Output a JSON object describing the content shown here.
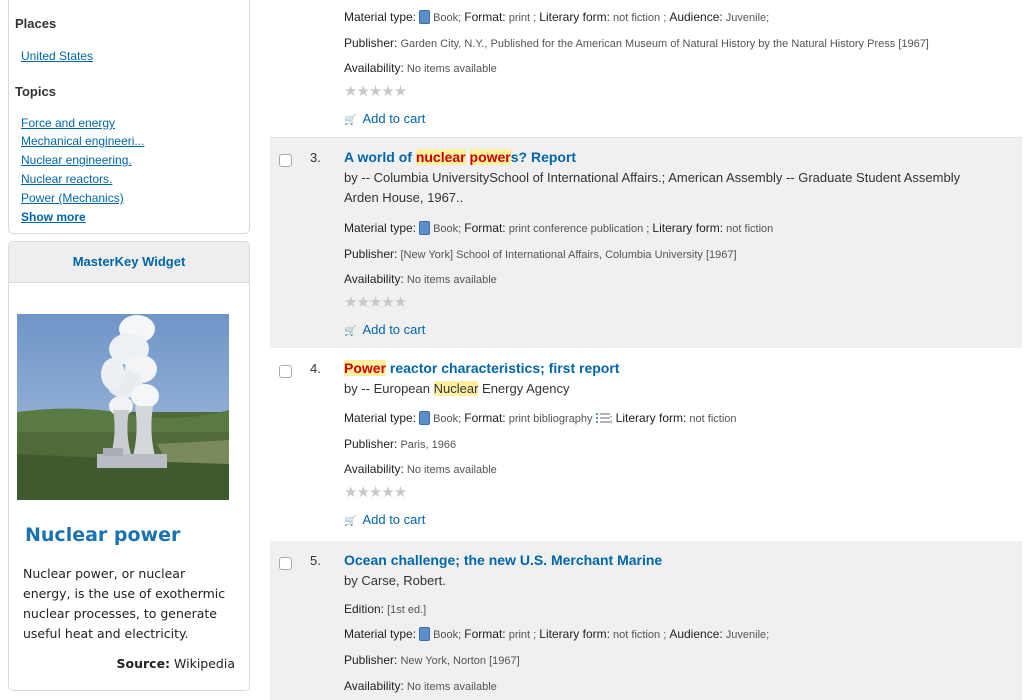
{
  "sidebar": {
    "places_heading": "Places",
    "places": [
      "United States"
    ],
    "topics_heading": "Topics",
    "topics": [
      "Force and energy",
      "Mechanical engineeri...",
      "Nuclear engineering.",
      "Nuclear reactors.",
      "Power (Mechanics)"
    ],
    "show_more": "Show more"
  },
  "widget": {
    "header": "MasterKey Widget",
    "title": "Nuclear power",
    "text": "Nuclear power, or nuclear energy, is the use of exothermic nuclear processes, to generate useful heat and electricity.",
    "source_label": "Source:",
    "source_value": "Wikipedia"
  },
  "labels": {
    "material_type": "Material type:",
    "format": "Format:",
    "literary_form": "Literary form:",
    "audience": "Audience:",
    "publisher": "Publisher:",
    "availability": "Availability:",
    "edition": "Edition:",
    "add_to_cart": "Add to cart",
    "book": "Book;",
    "sep": ";",
    "stars": "★★★★★"
  },
  "results": [
    {
      "format": "print",
      "literary_form": "not fiction",
      "audience": "Juvenile;",
      "publisher": "Garden City, N.Y., Published for the American Museum of Natural History by the Natural History Press [1967]",
      "availability": "No items available"
    },
    {
      "number": "3.",
      "title_pre": "A world of ",
      "title_hl1": "nuclear",
      "title_mid": " ",
      "title_hl2": "power",
      "title_post": "s? Report",
      "author_line1": "by -- Columbia UniversitySchool of International Affairs.; American Assembly -- Graduate Student Assembly",
      "author_line2": "Arden House, 1967..",
      "format": "print conference publication",
      "literary_form": "not fiction",
      "publisher": "[New York] School of International Affairs, Columbia University [1967]",
      "availability": "No items available"
    },
    {
      "number": "4.",
      "title_hl": "Power",
      "title_post": " reactor characteristics; first report",
      "author_pre": "by -- European ",
      "author_hl": "Nuclear",
      "author_post": " Energy Agency",
      "format": "print bibliography",
      "literary_form": "not fiction",
      "publisher": "Paris, 1966",
      "availability": "No items available"
    },
    {
      "number": "5.",
      "title": "Ocean challenge; the new U.S. Merchant Marine",
      "author": "by Carse, Robert.",
      "edition": "[1st ed.]",
      "format": "print",
      "literary_form": "not fiction",
      "audience": "Juvenile;",
      "publisher": "New York, Norton [1967]",
      "availability": "No items available"
    }
  ]
}
